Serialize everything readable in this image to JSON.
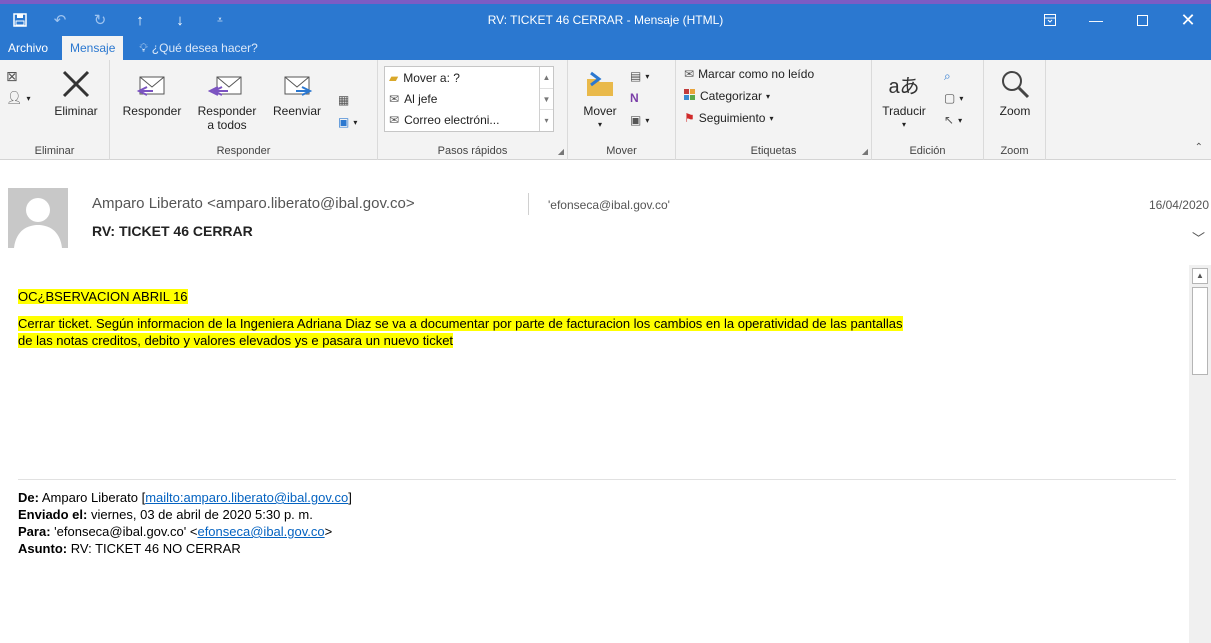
{
  "window": {
    "title": "RV: TICKET 46 CERRAR - Mensaje (HTML)",
    "controls": [
      "restore",
      "minimize",
      "maximize",
      "close"
    ]
  },
  "tabs": {
    "archivo": "Archivo",
    "mensaje": "Mensaje",
    "help": "¿Qué desea hacer?"
  },
  "ribbon": {
    "eliminar_group": {
      "label": "Eliminar",
      "eliminar_btn": "Eliminar"
    },
    "responder_group": {
      "label": "Responder",
      "responder": "Responder",
      "responder_todos_1": "Responder",
      "responder_todos_2": "a todos",
      "reenviar": "Reenviar"
    },
    "pasos_group": {
      "label": "Pasos rápidos",
      "items": [
        "Mover a: ?",
        "Al jefe",
        "Correo electróni..."
      ]
    },
    "mover_group": {
      "label": "Mover",
      "mover_btn": "Mover"
    },
    "etiquetas_group": {
      "label": "Etiquetas",
      "marcar": "Marcar como no leído",
      "categorizar": "Categorizar",
      "seguimiento": "Seguimiento"
    },
    "edicion_group": {
      "label": "Edición",
      "traducir": "Traducir"
    },
    "zoom_group": {
      "label": "Zoom",
      "zoom_btn": "Zoom"
    }
  },
  "message": {
    "from": "Amparo Liberato <amparo.liberato@ibal.gov.co>",
    "to": "'efonseca@ibal.gov.co'",
    "date": "16/04/2020",
    "subject": "RV: TICKET 46 CERRAR",
    "body_line1": "OC¿BSERVACION ABRIL 16",
    "body_line2a": "Cerrar ticket. Según informacion de la Ingeniera Adriana Diaz se va a documentar por parte de facturacion los cambios en la operatividad de las pantallas",
    "body_line2b": "de las notas creditos, debito y valores elevados  ys e pasara un nuevo ticket",
    "meta": {
      "de_label": "De:",
      "de_name": "Amparo Liberato [",
      "de_link": "mailto:amparo.liberato@ibal.gov.co",
      "de_close": "]",
      "enviado_label": "Enviado el:",
      "enviado_value": "viernes, 03 de abril de 2020 5:30 p. m.",
      "para_label": "Para:",
      "para_value": "'efonseca@ibal.gov.co' <",
      "para_link": "efonseca@ibal.gov.co",
      "para_close": ">",
      "asunto_label": "Asunto:",
      "asunto_value": "RV: TICKET 46 NO CERRAR"
    }
  },
  "colors": {
    "titlebar": "#2b78d0",
    "highlight": "#ffff00",
    "link": "#0563c1"
  }
}
